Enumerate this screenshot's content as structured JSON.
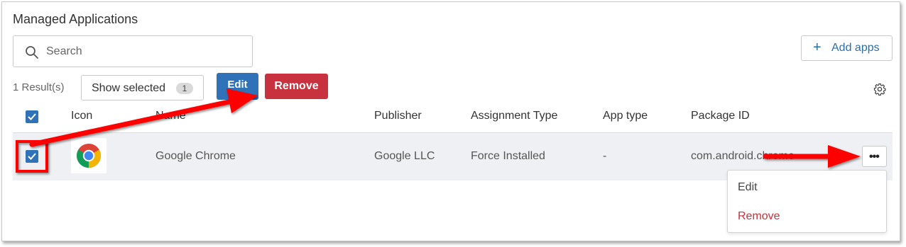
{
  "panel": {
    "title": "Managed Applications",
    "search_placeholder": "Search",
    "add_apps_label": "Add apps",
    "results_text": "1 Result(s)",
    "show_selected_label": "Show selected",
    "show_selected_count": "1",
    "edit_label": "Edit",
    "remove_label": "Remove"
  },
  "table": {
    "headers": {
      "icon": "Icon",
      "name": "Name",
      "publisher": "Publisher",
      "assignment_type": "Assignment Type",
      "app_type": "App type",
      "package_id": "Package ID"
    },
    "rows": [
      {
        "selected": true,
        "icon": "chrome-icon",
        "name": "Google Chrome",
        "publisher": "Google LLC",
        "assignment_type": "Force Installed",
        "app_type": "-",
        "package_id": "com.android.chrome"
      }
    ]
  },
  "row_menu": {
    "trigger_label": "•••",
    "items": [
      "Edit",
      "Remove"
    ]
  },
  "colors": {
    "accent_blue": "#2f72b8",
    "danger_red": "#c8323e",
    "annotation_red": "#ff0000"
  }
}
